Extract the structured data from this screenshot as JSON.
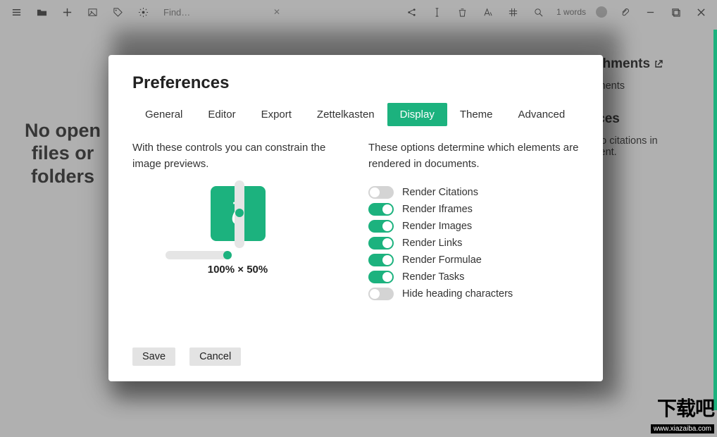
{
  "toolbar": {
    "search_placeholder": "Find…",
    "word_count": "1 words"
  },
  "bg": {
    "no_open": "No open files or folders",
    "attachments_title": "Attachments",
    "attachments_text": "attachments",
    "references_title": "erences",
    "references_text": "e are no citations in document."
  },
  "modal": {
    "title": "Preferences",
    "tabs": [
      "General",
      "Editor",
      "Export",
      "Zettelkasten",
      "Display",
      "Theme",
      "Advanced"
    ],
    "active_tab": "Display",
    "left_desc": "With these controls you can constrain the image previews.",
    "dim_label": "100% × 50%",
    "right_desc": "These options determine which elements are rendered in documents.",
    "toggles": [
      {
        "label": "Render Citations",
        "on": false
      },
      {
        "label": "Render Iframes",
        "on": true
      },
      {
        "label": "Render Images",
        "on": true
      },
      {
        "label": "Render Links",
        "on": true
      },
      {
        "label": "Render Formulae",
        "on": true
      },
      {
        "label": "Render Tasks",
        "on": true
      },
      {
        "label": "Hide heading characters",
        "on": false
      }
    ],
    "save": "Save",
    "cancel": "Cancel"
  },
  "watermark": {
    "text": "下载吧",
    "url": "www.xiazaiba.com"
  }
}
